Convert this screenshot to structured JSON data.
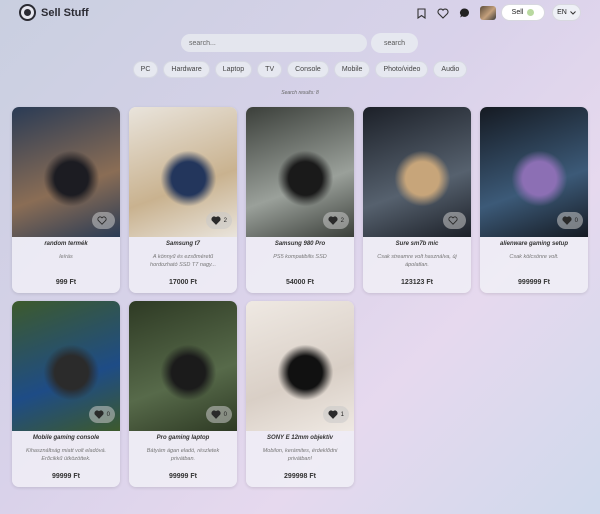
{
  "header": {
    "brand": "Sell Stuff",
    "sell_label": "Sell",
    "lang": "EN",
    "icons": [
      "bookmark-icon",
      "heart-icon",
      "chat-icon",
      "avatar"
    ]
  },
  "search": {
    "placeholder": "search...",
    "button_label": "search"
  },
  "categories": [
    "PC",
    "Hardware",
    "Laptop",
    "TV",
    "Console",
    "Mobile",
    "Photo/video",
    "Audio"
  ],
  "results_text": "Search results: 8",
  "products": [
    {
      "name": "random termék",
      "desc": "leírás",
      "price": "999 Ft",
      "likes": "",
      "img_colors": [
        "#2a3b55",
        "#8a6d55",
        "#1c1c22"
      ]
    },
    {
      "name": "Samsung t7",
      "desc": "A könnyű és ezsőméretű hordozható SSD T7 nagy...",
      "price": "17000 Ft",
      "likes": "2",
      "img_colors": [
        "#e9e4dc",
        "#c9b28f",
        "#23365c"
      ]
    },
    {
      "name": "Samsung 980 Pro",
      "desc": "PS5 kompatibilis SSD",
      "price": "54000 Ft",
      "likes": "2",
      "img_colors": [
        "#3b3f3a",
        "#9aa09a",
        "#1a1a1a"
      ]
    },
    {
      "name": "Sure sm7b mic",
      "desc": "Csak streamre volt használva, új ápolatlan.",
      "price": "123123 Ft",
      "likes": "",
      "img_colors": [
        "#1c2028",
        "#56616e",
        "#c7a57a"
      ]
    },
    {
      "name": "alienware gaming setup",
      "desc": "Csak kölcsönre volt.",
      "price": "999999 Ft",
      "likes": "0",
      "img_colors": [
        "#151a22",
        "#3c5a78",
        "#8c6fb4"
      ]
    },
    {
      "name": "Mobile gaming console",
      "desc": "Kihasználtság miatt volt eladóvá. Erőcikkű ütközöttek.",
      "price": "99999 Ft",
      "likes": "0",
      "img_colors": [
        "#3d5a2c",
        "#1e4c86",
        "#2b2b2b"
      ]
    },
    {
      "name": "Pro gaming laptop",
      "desc": "Bátyám ágan eladó, részletek privátban.",
      "price": "99999 Ft",
      "likes": "0",
      "img_colors": [
        "#2e3a24",
        "#576a4a",
        "#1b1b1b"
      ]
    },
    {
      "name": "SONY E 12mm objektív",
      "desc": "Mobilon, kerámites, érdeklődni privátban!",
      "price": "299998 Ft",
      "likes": "1",
      "img_colors": [
        "#efe9e3",
        "#d9cfc6",
        "#111111"
      ]
    }
  ]
}
